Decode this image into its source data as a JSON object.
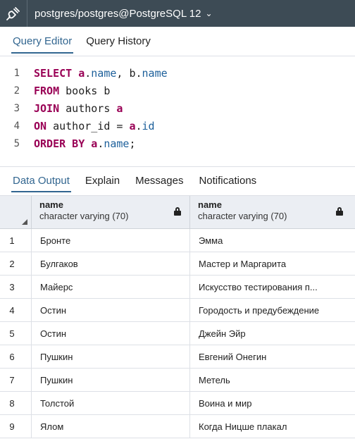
{
  "connection": {
    "icon": "plug-icon",
    "title": "postgres/postgres@PostgreSQL 12",
    "chevron": "⌄"
  },
  "editor_tabs": [
    {
      "label": "Query Editor",
      "active": true
    },
    {
      "label": "Query History",
      "active": false
    }
  ],
  "code": {
    "line_numbers": [
      "1",
      "2",
      "3",
      "4",
      "5"
    ],
    "tokens": {
      "select": "SELECT",
      "a1": "a",
      "name1": "name",
      "comma": ", ",
      "b1": "b",
      "name2": "name",
      "from": "FROM",
      "from_rest": " books b",
      "join": "JOIN",
      "join_rest": " authors ",
      "a2": "a",
      "on": "ON",
      "on_rest": " author_id = ",
      "a3": "a",
      "id": "id",
      "order_by": "ORDER BY",
      "a4": "a",
      "name3": "name",
      "semicolon": ";"
    }
  },
  "output_tabs": [
    {
      "label": "Data Output",
      "active": true
    },
    {
      "label": "Explain",
      "active": false
    },
    {
      "label": "Messages",
      "active": false
    },
    {
      "label": "Notifications",
      "active": false
    }
  ],
  "grid": {
    "columns": [
      {
        "name": "name",
        "type": "character varying (70)",
        "locked": true
      },
      {
        "name": "name",
        "type": "character varying (70)",
        "locked": true
      }
    ],
    "rows": [
      {
        "num": "1",
        "c1": "Бронте",
        "c2": "Эмма"
      },
      {
        "num": "2",
        "c1": "Булгаков",
        "c2": "Мастер и Маргарита"
      },
      {
        "num": "3",
        "c1": "Майерс",
        "c2": "Искусство тестирования п..."
      },
      {
        "num": "4",
        "c1": "Остин",
        "c2": "Городость и предубеждение"
      },
      {
        "num": "5",
        "c1": "Остин",
        "c2": "Джейн Эйр"
      },
      {
        "num": "6",
        "c1": "Пушкин",
        "c2": "Евгений Онегин"
      },
      {
        "num": "7",
        "c1": "Пушкин",
        "c2": "Метель"
      },
      {
        "num": "8",
        "c1": "Толстой",
        "c2": "Воина и мир"
      },
      {
        "num": "9",
        "c1": "Ялом",
        "c2": "Когда Ницше плакал"
      }
    ]
  },
  "colors": {
    "connection_bar": "#3d4b55",
    "accent": "#326690",
    "keyword": "#990055",
    "property": "#1c5f9a",
    "grid_header": "#ebeef3"
  }
}
